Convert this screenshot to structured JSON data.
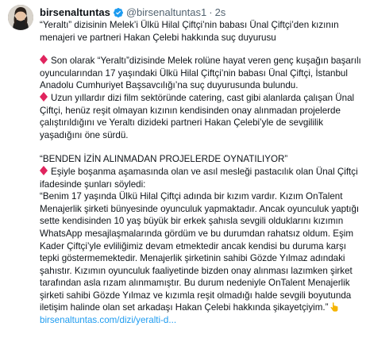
{
  "tweet": {
    "display_name": "birsenaltuntas",
    "handle": "@birsenaltuntas1",
    "separator": "·",
    "time": "2s",
    "paragraphs": {
      "p1": "“Yeraltı” dizisinin Melek’i Ülkü Hilal Çiftçi’nin babası Ünal Çiftçi’den kızının menajeri ve partneri Hakan Çelebi hakkında suç duyurusu",
      "p2": "Son olarak “Yeraltı”dizisinde Melek rolüne hayat veren genç kuşağın başarılı oyuncularından 17 yaşındaki Ülkü Hilal Çiftçi’nin babası Ünal Çiftçi, İstanbul Anadolu Cumhuriyet Başsavcılığı’na suç duyurusunda bulundu.",
      "p3": "Uzun yıllardır dizi film sektöründe catering, cast gibi alanlarda çalışan Ünal Çiftçi, henüz reşit olmayan kızının kendisinden onay alınmadan projelerde çalıştırıldığını ve Yeraltı dizideki partneri Hakan Çelebi’yle de sevgililik yaşadığını öne sürdü.",
      "heading": "“BENDEN İZİN ALINMADAN PROJELERDE OYNATILIYOR”",
      "p4": "Eşiyle boşanma aşamasında olan ve asıl mesleği pastacılık olan Ünal Çiftçi ifadesinde şunları söyledi:",
      "quote": "“Benim 17 yaşında Ülkü Hilal Çiftçi adında bir kızım vardır. Kızım OnTalent Menajerlik şirketi bünyesinde oyunculuk yapmaktadır. Ancak oyunculuk yaptığı sette kendisinden 10 yaş büyük bir erkek şahısla sevgili olduklarını kızımın WhatsApp mesajlaşmalarında gördüm ve bu durumdan rahatsız oldum. Eşim Kader Çiftçi’yle evliliğimiz devam etmektedir ancak kendisi bu duruma karşı tepki göstermemektedir. Menajerlik şirketinin sahibi Gözde Yılmaz adındaki şahıstır. Kızımın oyunculuk faaliyetinde bizden onay alınması lazımken şirket tarafından asla rızam alınmamıştır. Bu durum nedeniyle OnTalent Menajerlik şirketi sahibi Gözde Yılmaz ve kızımla reşit olmadığı halde sevgili boyutunda iletişim halinde olan set arkadaşı Hakan Çelebi hakkında şikayetçiyim.”"
    },
    "link": "birsenaltuntas.com/dizi/yeralti-d...",
    "icons": {
      "avatar": "avatar",
      "verified": "verified-badge-icon",
      "bullet": "red-diamond-icon",
      "pointing": "backhand-index-pointing-down-icon"
    },
    "colors": {
      "text": "#0f1419",
      "secondary": "#536471",
      "link": "#1d9bf0",
      "verified": "#1d9bf0",
      "bullet": "#e0245e"
    }
  }
}
